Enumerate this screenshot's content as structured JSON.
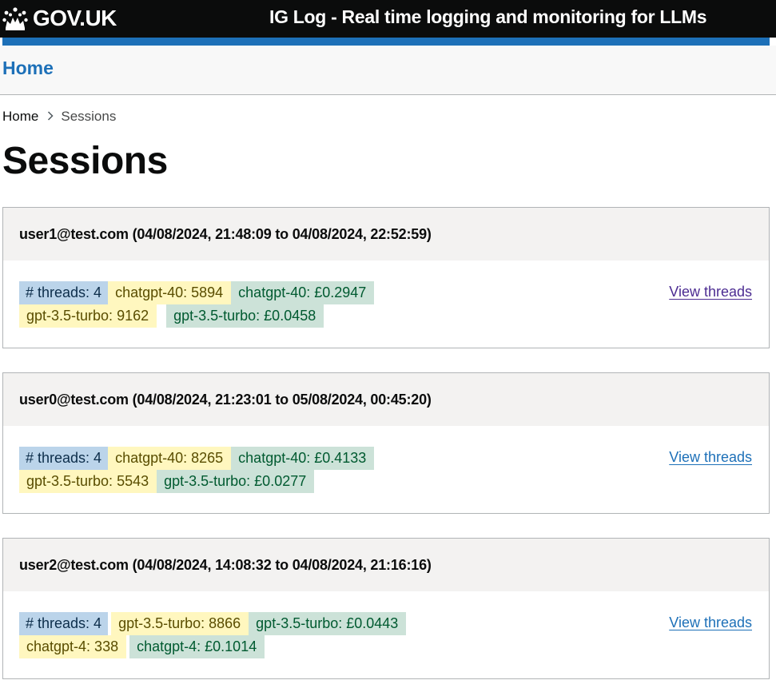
{
  "header": {
    "logo_text": "GOV.UK",
    "service_name": "IG Log - Real time logging and monitoring for LLMs"
  },
  "nav": {
    "home_label": "Home"
  },
  "breadcrumb": {
    "home": "Home",
    "current": "Sessions"
  },
  "page": {
    "title": "Sessions"
  },
  "sessions": [
    {
      "title": "user1@test.com (04/08/2024, 21:48:09 to 04/08/2024, 22:52:59)",
      "threads": "# threads: 4",
      "row1_tokens": "chatgpt-40: 5894",
      "row1_cost": "chatgpt-40: £0.2947",
      "row2_tokens": "gpt-3.5-turbo: 9162",
      "row2_cost": "gpt-3.5-turbo: £0.0458",
      "link": "View threads"
    },
    {
      "title": "user0@test.com (04/08/2024, 21:23:01 to 05/08/2024, 00:45:20)",
      "threads": "# threads: 4",
      "row1_tokens": "chatgpt-40: 8265",
      "row1_cost": "chatgpt-40: £0.4133",
      "row2_tokens": "gpt-3.5-turbo: 5543",
      "row2_cost": "gpt-3.5-turbo: £0.0277",
      "link": "View threads"
    },
    {
      "title": "user2@test.com (04/08/2024, 14:08:32 to 04/08/2024, 21:16:16)",
      "threads": "# threads: 4",
      "row1_tokens": "gpt-3.5-turbo: 8866",
      "row1_cost": "gpt-3.5-turbo: £0.0443",
      "row2_tokens": "chatgpt-4: 338",
      "row2_cost": "chatgpt-4: £0.1014",
      "link": "View threads"
    }
  ],
  "colors": {
    "header_bg": "#0b0c0c",
    "brand_blue": "#1d70b8",
    "tag_blue": "#bbd4ea",
    "tag_yellow": "#fff7bf",
    "tag_green": "#cce2d8",
    "visited_link": "#4c2c92"
  },
  "icons": {
    "logo": "crown-icon",
    "breadcrumb_separator": "chevron-right-icon"
  }
}
